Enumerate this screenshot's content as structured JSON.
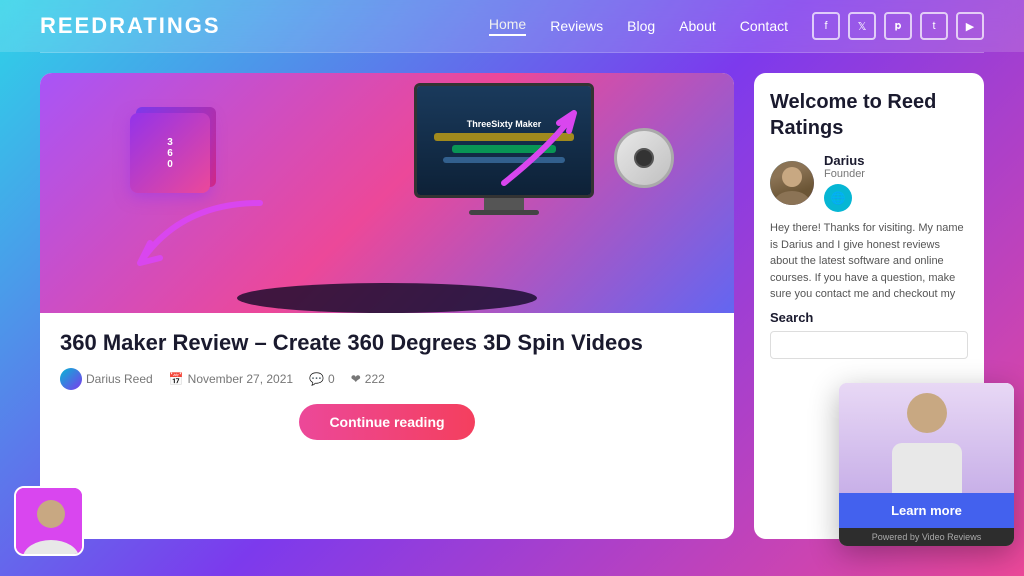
{
  "header": {
    "logo": "ReedRatings",
    "nav": {
      "home": "Home",
      "reviews": "Reviews",
      "blog": "Blog",
      "about": "About",
      "contact": "Contact"
    },
    "social": {
      "facebook": "f",
      "twitter": "t",
      "pinterest": "p",
      "tumblr": "t",
      "youtube": "▶"
    }
  },
  "article": {
    "title": "360 Maker Review – Create 360 Degrees 3D Spin Videos",
    "author": "Darius Reed",
    "date": "November 27, 2021",
    "comments": "0",
    "likes": "222",
    "continue_label": "Continue reading",
    "product_name": "ThreeSixty Maker"
  },
  "sidebar": {
    "welcome_title": "Welcome to Reed Ratings",
    "founder_name": "Darius",
    "founder_role": "Founder",
    "welcome_text": "Hey there! Thanks for visiting. My name is Darius and I give honest reviews about the latest software and online courses. If you have a question, make sure you contact me and checkout my YouTube channel. I also do video reviews.",
    "search_label": "Search",
    "search_placeholder": "",
    "learn_more_label": "Learn more",
    "powered_by": "Powered by Video Reviews"
  }
}
